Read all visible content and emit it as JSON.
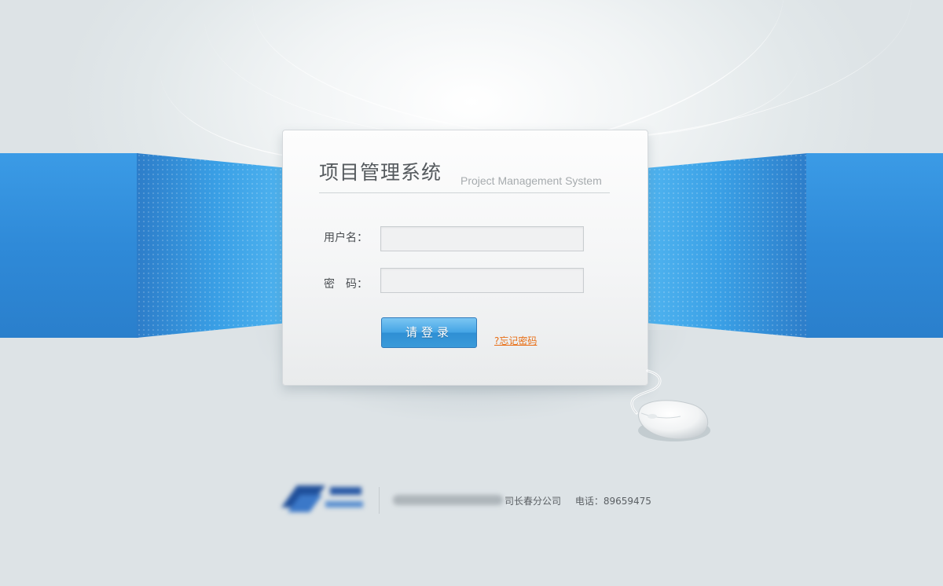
{
  "app": {
    "title_cn": "项目管理系统",
    "title_en": "Project Management System"
  },
  "form": {
    "username_label": "用户名：",
    "username_value": "",
    "password_label": "密　码：",
    "password_value": "",
    "login_button": "请登录",
    "forgot_password": "?忘记密码"
  },
  "footer": {
    "company_partial": "司长春分公司",
    "phone": "电话：89659475"
  },
  "colors": {
    "accent_blue": "#3a9ad9",
    "link_orange": "#e86e15",
    "title_gray": "#555a5e"
  },
  "icons": {
    "mouse": "computer-mouse-icon",
    "logo": "company-logo"
  }
}
